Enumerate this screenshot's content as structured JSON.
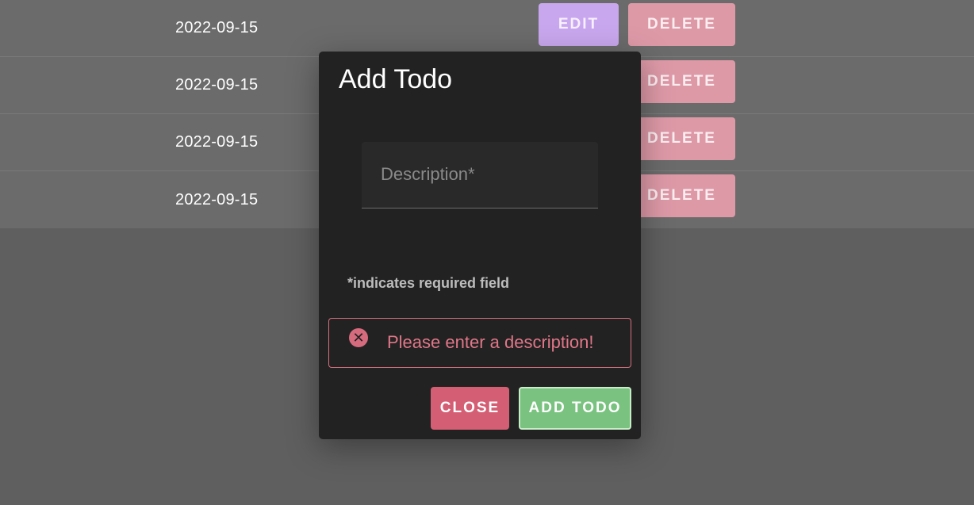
{
  "rows": [
    {
      "date": "2022-09-15",
      "edit_label": "EDIT",
      "delete_label": "DELETE"
    },
    {
      "date": "2022-09-15",
      "delete_label": "DELETE"
    },
    {
      "date": "2022-09-15",
      "delete_label": "DELETE"
    },
    {
      "date": "2022-09-15",
      "delete_label": "DELETE"
    }
  ],
  "dialog": {
    "title": "Add Todo",
    "description_label": "Description*",
    "description_value": "",
    "required_note": "*indicates required field",
    "error_message": "Please enter a description!",
    "error_icon": "error-circle-icon",
    "close_label": "CLOSE",
    "add_label": "ADD TODO"
  },
  "colors": {
    "edit": "#c9a7ee",
    "delete": "#de99a7",
    "close": "#d45e73",
    "add": "#79c27f",
    "error": "#d4707f"
  }
}
